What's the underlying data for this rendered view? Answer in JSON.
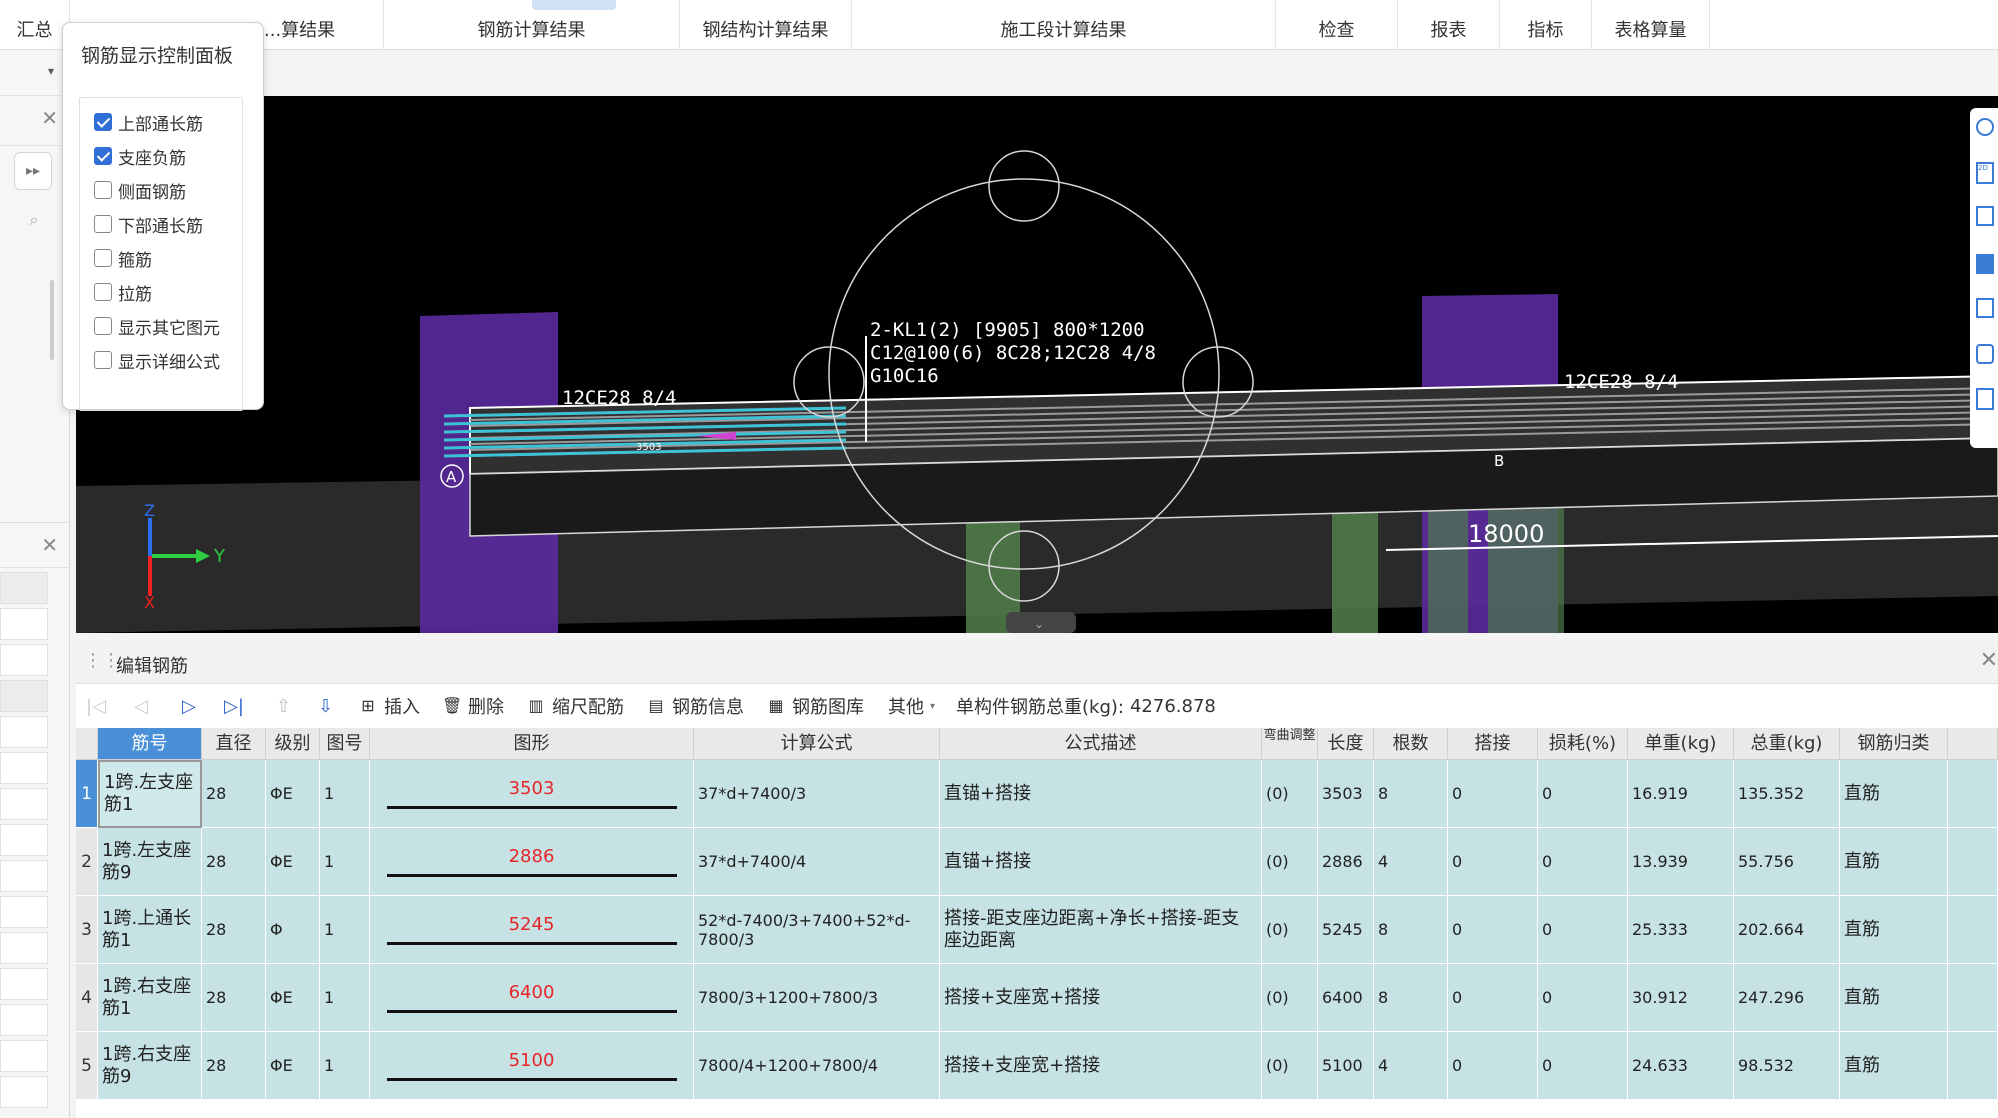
{
  "tabs": [
    {
      "label": "汇总"
    },
    {
      "label": "...算结果"
    },
    {
      "label": "钢筋计算结果"
    },
    {
      "label": "钢结构计算结果"
    },
    {
      "label": "施工段计算结果"
    },
    {
      "label": "检查"
    },
    {
      "label": "报表"
    },
    {
      "label": "指标"
    },
    {
      "label": "表格算量"
    }
  ],
  "control_panel": {
    "title": "钢筋显示控制面板",
    "items": [
      {
        "label": "上部通长筋",
        "checked": true
      },
      {
        "label": "支座负筋",
        "checked": true
      },
      {
        "label": "侧面钢筋",
        "checked": false
      },
      {
        "label": "下部通长筋",
        "checked": false
      },
      {
        "label": "箍筋",
        "checked": false
      },
      {
        "label": "拉筋",
        "checked": false
      },
      {
        "label": "显示其它图元",
        "checked": false
      },
      {
        "label": "显示详细公式",
        "checked": false
      }
    ]
  },
  "viewport": {
    "beam_label_1": "2-KL1(2) [9905] 800*1200",
    "beam_label_2": "C12@100(6) 8C28;12C28 4/8",
    "beam_label_3": "G10C16",
    "left_rebar_label": "12CE28 8/4",
    "right_rebar_label": "12CE28 8/4",
    "small_dim": "3503",
    "span_dim": "18000",
    "axis_a": "A",
    "axis_b": "B",
    "axis_y": "Y",
    "axis_z": "Z",
    "axis_x": "X"
  },
  "editor": {
    "title": "编辑钢筋",
    "toolbar": {
      "insert": "插入",
      "delete": "删除",
      "scale": "缩尺配筋",
      "info": "钢筋信息",
      "library": "钢筋图库",
      "other": "其他",
      "total_label": "单构件钢筋总重(kg):",
      "total_value": "4276.878"
    },
    "columns": [
      "筋号",
      "直径(mm)",
      "级别",
      "图号",
      "图形",
      "计算公式",
      "公式描述",
      "弯曲调整",
      "长度",
      "根数",
      "搭接",
      "损耗(%)",
      "单重(kg)",
      "总重(kg)",
      "钢筋归类"
    ],
    "rows": [
      {
        "no": "1",
        "name": "1跨.左支座筋1",
        "dia": "28",
        "grade": "ΦE",
        "fig": "1",
        "shape": "3503",
        "formula": "37*d+7400/3",
        "desc": "直锚+搭接",
        "bend": "(0)",
        "len": "3503",
        "count": "8",
        "lap": "0",
        "loss": "0",
        "unit": "16.919",
        "total": "135.352",
        "cat": "直筋"
      },
      {
        "no": "2",
        "name": "1跨.左支座筋9",
        "dia": "28",
        "grade": "ΦE",
        "fig": "1",
        "shape": "2886",
        "formula": "37*d+7400/4",
        "desc": "直锚+搭接",
        "bend": "(0)",
        "len": "2886",
        "count": "4",
        "lap": "0",
        "loss": "0",
        "unit": "13.939",
        "total": "55.756",
        "cat": "直筋"
      },
      {
        "no": "3",
        "name": "1跨.上通长筋1",
        "dia": "28",
        "grade": "Φ",
        "fig": "1",
        "shape": "5245",
        "formula": "52*d-7400/3+7400+52*d-7800/3",
        "desc": "搭接-距支座边距离+净长+搭接-距支座边距离",
        "bend": "(0)",
        "len": "5245",
        "count": "8",
        "lap": "0",
        "loss": "0",
        "unit": "25.333",
        "total": "202.664",
        "cat": "直筋"
      },
      {
        "no": "4",
        "name": "1跨.右支座筋1",
        "dia": "28",
        "grade": "ΦE",
        "fig": "1",
        "shape": "6400",
        "formula": "7800/3+1200+7800/3",
        "desc": "搭接+支座宽+搭接",
        "bend": "(0)",
        "len": "6400",
        "count": "8",
        "lap": "0",
        "loss": "0",
        "unit": "30.912",
        "total": "247.296",
        "cat": "直筋"
      },
      {
        "no": "5",
        "name": "1跨.右支座筋9",
        "dia": "28",
        "grade": "ΦE",
        "fig": "1",
        "shape": "5100",
        "formula": "7800/4+1200+7800/4",
        "desc": "搭接+支座宽+搭接",
        "bend": "(0)",
        "len": "5100",
        "count": "4",
        "lap": "0",
        "loss": "0",
        "unit": "24.633",
        "total": "98.532",
        "cat": "直筋"
      }
    ]
  },
  "colors": {
    "row_bg": "#c6e2e4",
    "header_selected": "#4a90d9",
    "shape_text": "#e8262a",
    "column_purple": "#5a2a9e",
    "column_green": "#4f7a48"
  }
}
